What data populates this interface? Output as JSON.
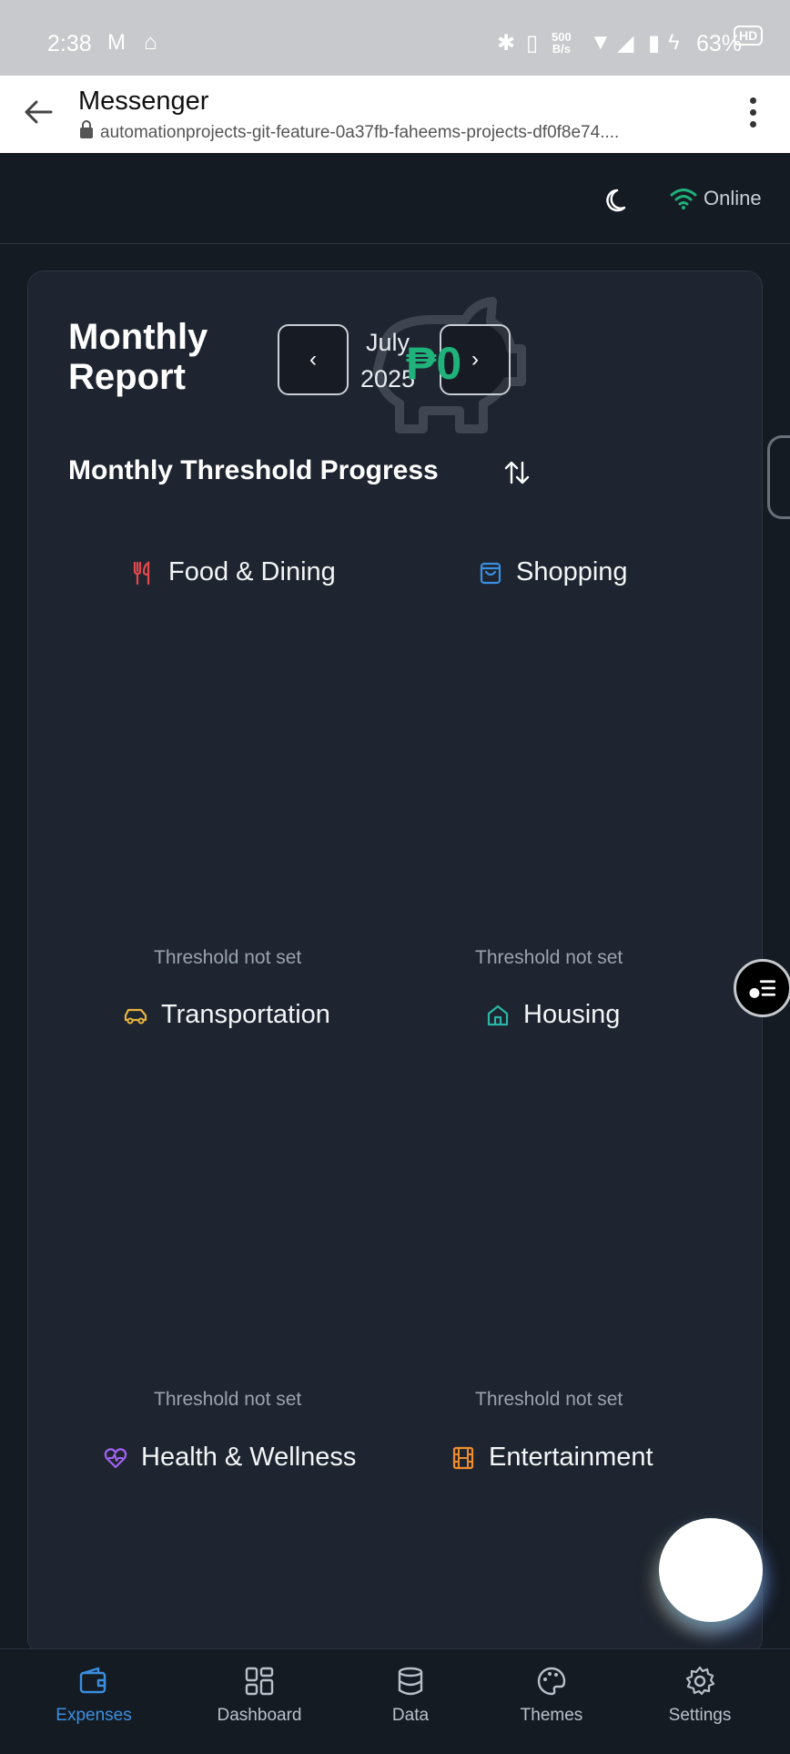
{
  "status_bar": {
    "time": "2:38",
    "net_speed_value": "500",
    "net_speed_unit": "B/s",
    "battery": "63%",
    "hd": "HD"
  },
  "browser": {
    "title": "Messenger",
    "url": "automationprojects-git-feature-0a37fb-faheems-projects-df0f8e74...."
  },
  "header": {
    "status": "Online",
    "status_color": "#1fb27a"
  },
  "report": {
    "title_line1": "Monthly",
    "title_line2": "Report",
    "month": "July",
    "year": "2025",
    "amount": "₱0",
    "prev_label": "‹",
    "next_label": "›"
  },
  "threshold": {
    "section_title": "Monthly Threshold Progress",
    "categories": [
      {
        "name": "Food & Dining",
        "icon": "utensils-icon",
        "color": "#e5484d",
        "status": "Threshold not set"
      },
      {
        "name": "Shopping",
        "icon": "shopping-bag-icon",
        "color": "#3b8fe0",
        "status": "Threshold not set"
      },
      {
        "name": "Transportation",
        "icon": "car-icon",
        "color": "#e6b43c",
        "status": "Threshold not set"
      },
      {
        "name": "Housing",
        "icon": "house-icon",
        "color": "#2bb5a6",
        "status": "Threshold not set"
      },
      {
        "name": "Health & Wellness",
        "icon": "heart-pulse-icon",
        "color": "#a463f2"
      },
      {
        "name": "Entertainment",
        "icon": "film-icon",
        "color": "#f08c2e"
      }
    ]
  },
  "bottom_nav": {
    "items": [
      {
        "label": "Expenses",
        "icon": "wallet-icon",
        "active": true
      },
      {
        "label": "Dashboard",
        "icon": "dashboard-icon"
      },
      {
        "label": "Data",
        "icon": "database-icon"
      },
      {
        "label": "Themes",
        "icon": "palette-icon"
      },
      {
        "label": "Settings",
        "icon": "gear-icon"
      }
    ],
    "active_color": "#3b8fe0"
  }
}
